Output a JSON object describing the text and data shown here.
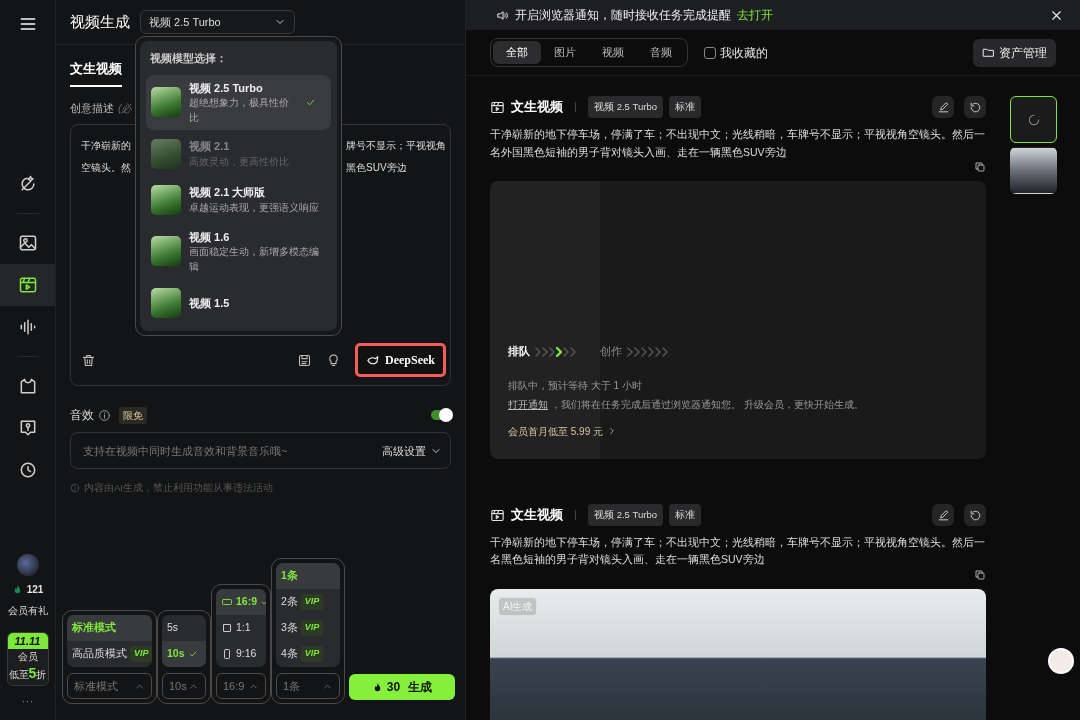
{
  "sidebar": {
    "groups": [
      [
        {
          "selected": false
        }
      ],
      [
        {
          "selected": false
        },
        {
          "selected": true
        },
        {
          "selected": false
        }
      ],
      [
        {
          "selected": false
        },
        {
          "selected": false
        },
        {
          "selected": false
        }
      ]
    ],
    "credits": "121",
    "gift_label": "会员有礼",
    "promo": {
      "title": "11.11",
      "line1": "会员",
      "line2": "低至**5**折"
    },
    "more": "···"
  },
  "header": {
    "title": "视频生成",
    "model_select": "视频 2.5 Turbo"
  },
  "tabs": [
    {
      "label": "文生视频",
      "selected": true
    }
  ],
  "prompt": {
    "label": "创意描述",
    "hint": "(必",
    "lines": [
      {
        "left": "干净崭新的",
        "right": "牌号不显示；平视视角"
      },
      {
        "left": "空镜头。然",
        "right": "黑色SUV旁边"
      }
    ],
    "deepseek_button": "DeepSeek"
  },
  "sound": {
    "label": "音效",
    "badge": "限免",
    "on": true,
    "placeholder": "支持在视频中同时生成音效和背景音乐哦~",
    "advanced": "高级设置"
  },
  "disclaimer": "内容由AI生成，禁止利用功能从事违法活动",
  "options": [
    {
      "kind": "mode",
      "value": "标准模式",
      "show_check": false,
      "options": [
        {
          "label": "标准模式",
          "selected": true
        },
        {
          "label": "高品质模式",
          "badge": "VIP",
          "selected": false
        }
      ]
    },
    {
      "kind": "duration",
      "value": "10s",
      "show_check": true,
      "options": [
        {
          "label": "5s",
          "selected": false
        },
        {
          "label": "10s",
          "selected": true
        }
      ]
    },
    {
      "kind": "ratio",
      "value": "16:9",
      "show_check": true,
      "options": [
        {
          "label": "16:9",
          "selected": true
        },
        {
          "label": "1:1",
          "selected": false
        },
        {
          "label": "9:16",
          "selected": false
        }
      ]
    },
    {
      "kind": "count",
      "value": "1条",
      "show_check": false,
      "options": [
        {
          "label": "1条",
          "selected": true
        },
        {
          "label": "2条",
          "badge": "VIP",
          "selected": false
        },
        {
          "label": "3条",
          "badge": "VIP",
          "selected": false
        },
        {
          "label": "4条",
          "badge": "VIP",
          "selected": false
        }
      ]
    }
  ],
  "generate": {
    "cost": "30",
    "label": "生成"
  },
  "model_dropdown": {
    "title": "视频模型选择：",
    "items": [
      {
        "name": "视频 2.5 Turbo",
        "desc": "超绝想象力，极具性价比",
        "selected": true,
        "disabled": false
      },
      {
        "name": "视频 2.1",
        "desc": "高效灵动，更高性价比",
        "selected": false,
        "disabled": true
      },
      {
        "name": "视频 2.1 大师版",
        "desc": "卓越运动表现，更强语义响应",
        "selected": false,
        "disabled": false
      },
      {
        "name": "视频 1.6",
        "desc": "画面稳定生动，新增多模态编辑",
        "selected": false,
        "disabled": false
      },
      {
        "name": "视频 1.5",
        "selected": false,
        "disabled": false
      }
    ]
  },
  "notice": {
    "text": "开启浏览器通知，随时接收任务完成提醒",
    "link": "去打开"
  },
  "filters": [
    {
      "label": "全部",
      "selected": true
    },
    {
      "label": "图片",
      "selected": false
    },
    {
      "label": "视频",
      "selected": false
    },
    {
      "label": "音频",
      "selected": false
    }
  ],
  "favorites": {
    "label": "我收藏的",
    "checked": false
  },
  "assets_button": "资产管理",
  "tasks": [
    {
      "kind": "queued",
      "title": "文生视频",
      "tags": [
        "视频 2.5 Turbo",
        "标准"
      ],
      "prompt": "干净崭新的地下停车场，停满了车；不出现中文；光线稍暗，车牌号不显示；平视视角空镜头。然后一名外国黑色短袖的男子背对镜头入画、走在一辆黑色SUV旁边",
      "stages": [
        {
          "label": "排队",
          "active": true,
          "steps": [
            {
              "lit": false
            },
            {
              "lit": false
            },
            {
              "lit": false
            },
            {
              "lit": true
            },
            {
              "lit": false
            },
            {
              "lit": false
            }
          ]
        },
        {
          "label": "创作",
          "active": false,
          "steps": [
            {
              "lit": false
            },
            {
              "lit": false
            },
            {
              "lit": false
            },
            {
              "lit": false
            },
            {
              "lit": false
            },
            {
              "lit": false
            }
          ]
        }
      ],
      "status": "排队中，预计等待 大于 1 小时",
      "notify_link": "打开通知",
      "notify_text": " ，我们将在任务完成后通过浏览器通知您。 升级会员，更快开始生成。",
      "promo": "会员首月低至 5.99 元"
    },
    {
      "kind": "video",
      "title": "文生视频",
      "tags": [
        "视频 2.5 Turbo",
        "标准"
      ],
      "prompt": "干净崭新的地下停车场，停满了车；不出现中文；光线稍暗，车牌号不显示；平视视角空镜头。然后一名黑色短袖的男子背对镜头入画、走在一辆黑色SUV旁边",
      "ai_label": "AI生成"
    }
  ],
  "thumbnails": [
    {
      "kind": "loading",
      "selected": true
    },
    {
      "kind": "photo",
      "selected": false
    }
  ]
}
